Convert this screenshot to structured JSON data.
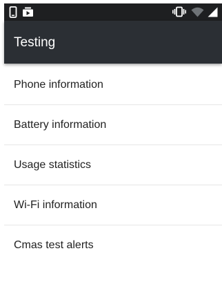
{
  "status_bar": {
    "left_icons": [
      "phone-notification-icon",
      "media-notification-icon"
    ],
    "right_icons": [
      "vibrate-icon",
      "wifi-icon",
      "cell-signal-icon"
    ],
    "background": "#1e1f21"
  },
  "app_bar": {
    "title": "Testing",
    "background": "#2b2f34"
  },
  "list": {
    "items": [
      {
        "label": "Phone information"
      },
      {
        "label": "Battery information"
      },
      {
        "label": "Usage statistics"
      },
      {
        "label": "Wi-Fi information"
      },
      {
        "label": "Cmas test alerts"
      }
    ]
  }
}
